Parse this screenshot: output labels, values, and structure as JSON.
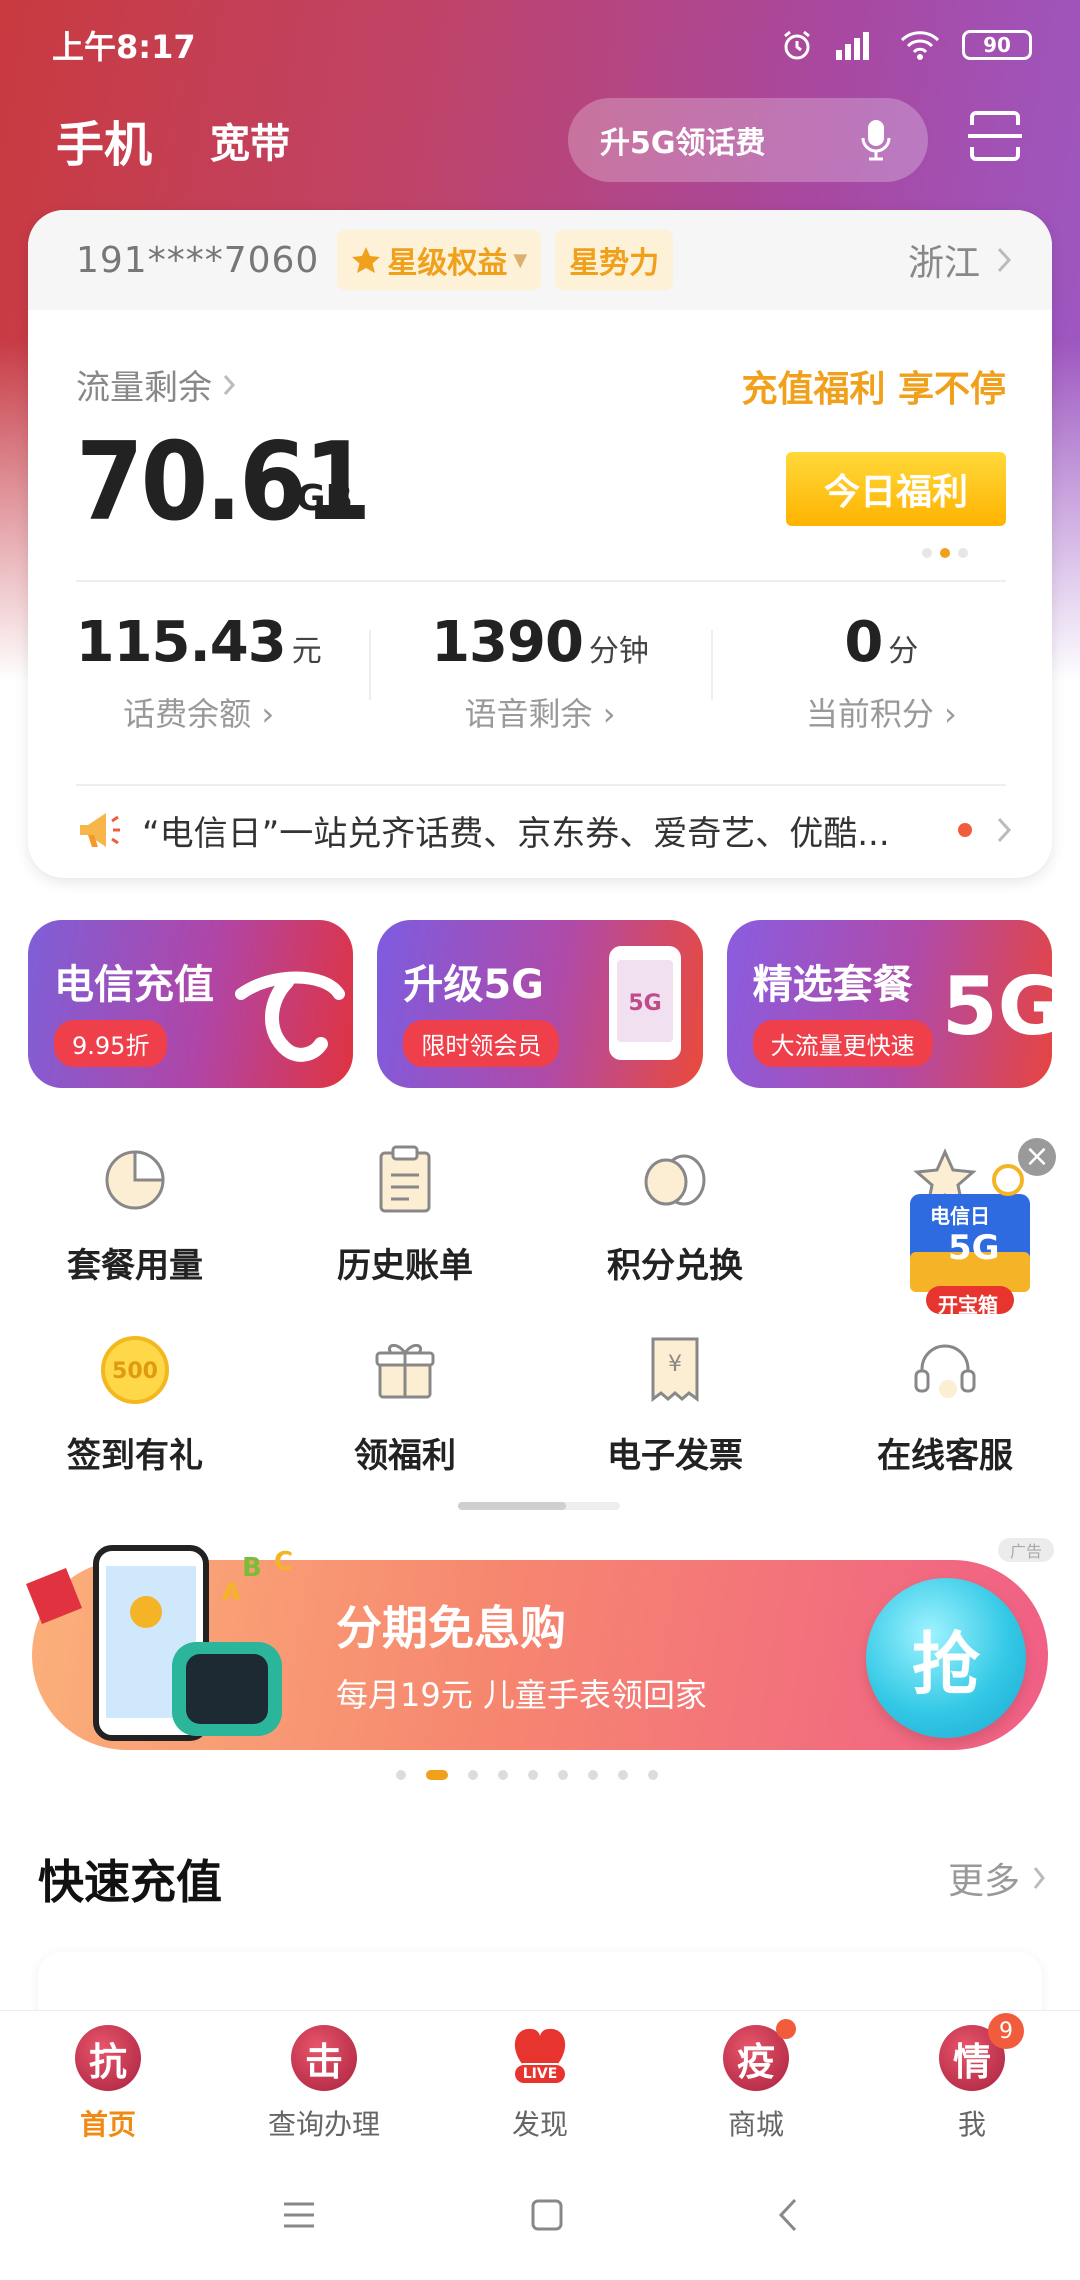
{
  "status_bar": {
    "time": "上午8:17",
    "battery": "90"
  },
  "top_nav": {
    "tab_phone": "手机",
    "tab_broadband": "宽带",
    "search_text": "升5G领话费"
  },
  "account": {
    "phone_number": "191****7060",
    "tag_star": "星级权益",
    "tag_power": "星势力",
    "province": "浙江",
    "data_label": "流量剩余",
    "data_value": "70.61",
    "data_unit": "GB",
    "promo_text": "充值福利 享不停",
    "promo_button": "今日福利",
    "stats": [
      {
        "value": "115.43",
        "unit": "元",
        "label": "话费余额"
      },
      {
        "value": "1390",
        "unit": "分钟",
        "label": "语音剩余"
      },
      {
        "value": "0",
        "unit": "分",
        "label": "当前积分"
      }
    ],
    "notice": "“电信日”一站兑齐话费、京东券、爱奇艺、优酷..."
  },
  "banners": [
    {
      "title": "电信充值",
      "sub": "9.95折"
    },
    {
      "title": "升级5G",
      "sub": "限时领会员"
    },
    {
      "title": "精选套餐",
      "sub": "大流量更快速"
    }
  ],
  "grid": [
    {
      "label": "套餐用量",
      "icon": "pie-chart-icon"
    },
    {
      "label": "历史账单",
      "icon": "clipboard-icon"
    },
    {
      "label": "积分兑换",
      "icon": "coins-icon"
    },
    {
      "label": "星",
      "icon": "star-icon"
    },
    {
      "label": "签到有礼",
      "icon": "coin-500-icon"
    },
    {
      "label": "领福利",
      "icon": "gift-icon"
    },
    {
      "label": "电子发票",
      "icon": "receipt-icon"
    },
    {
      "label": "在线客服",
      "icon": "headset-icon"
    }
  ],
  "float_badge": {
    "top": "电信日",
    "mid": "5G",
    "cta": "开宝箱"
  },
  "ad": {
    "tag": "广告",
    "title": "分期免息购",
    "subtitle": "每月19元 儿童手表领回家",
    "cta": "抢"
  },
  "quick_recharge": {
    "title": "快速充值",
    "more": "更多"
  },
  "tab_bar": [
    {
      "label": "首页",
      "glyph": "抗"
    },
    {
      "label": "查询办理",
      "glyph": "击"
    },
    {
      "label": "发现",
      "glyph": "LIVE"
    },
    {
      "label": "商城",
      "glyph": "疫"
    },
    {
      "label": "我",
      "glyph": "情",
      "badge": "9"
    }
  ],
  "colors": {
    "accent": "#f0a01a",
    "brand_red": "#e0333f",
    "purple": "#9b5ac8"
  }
}
